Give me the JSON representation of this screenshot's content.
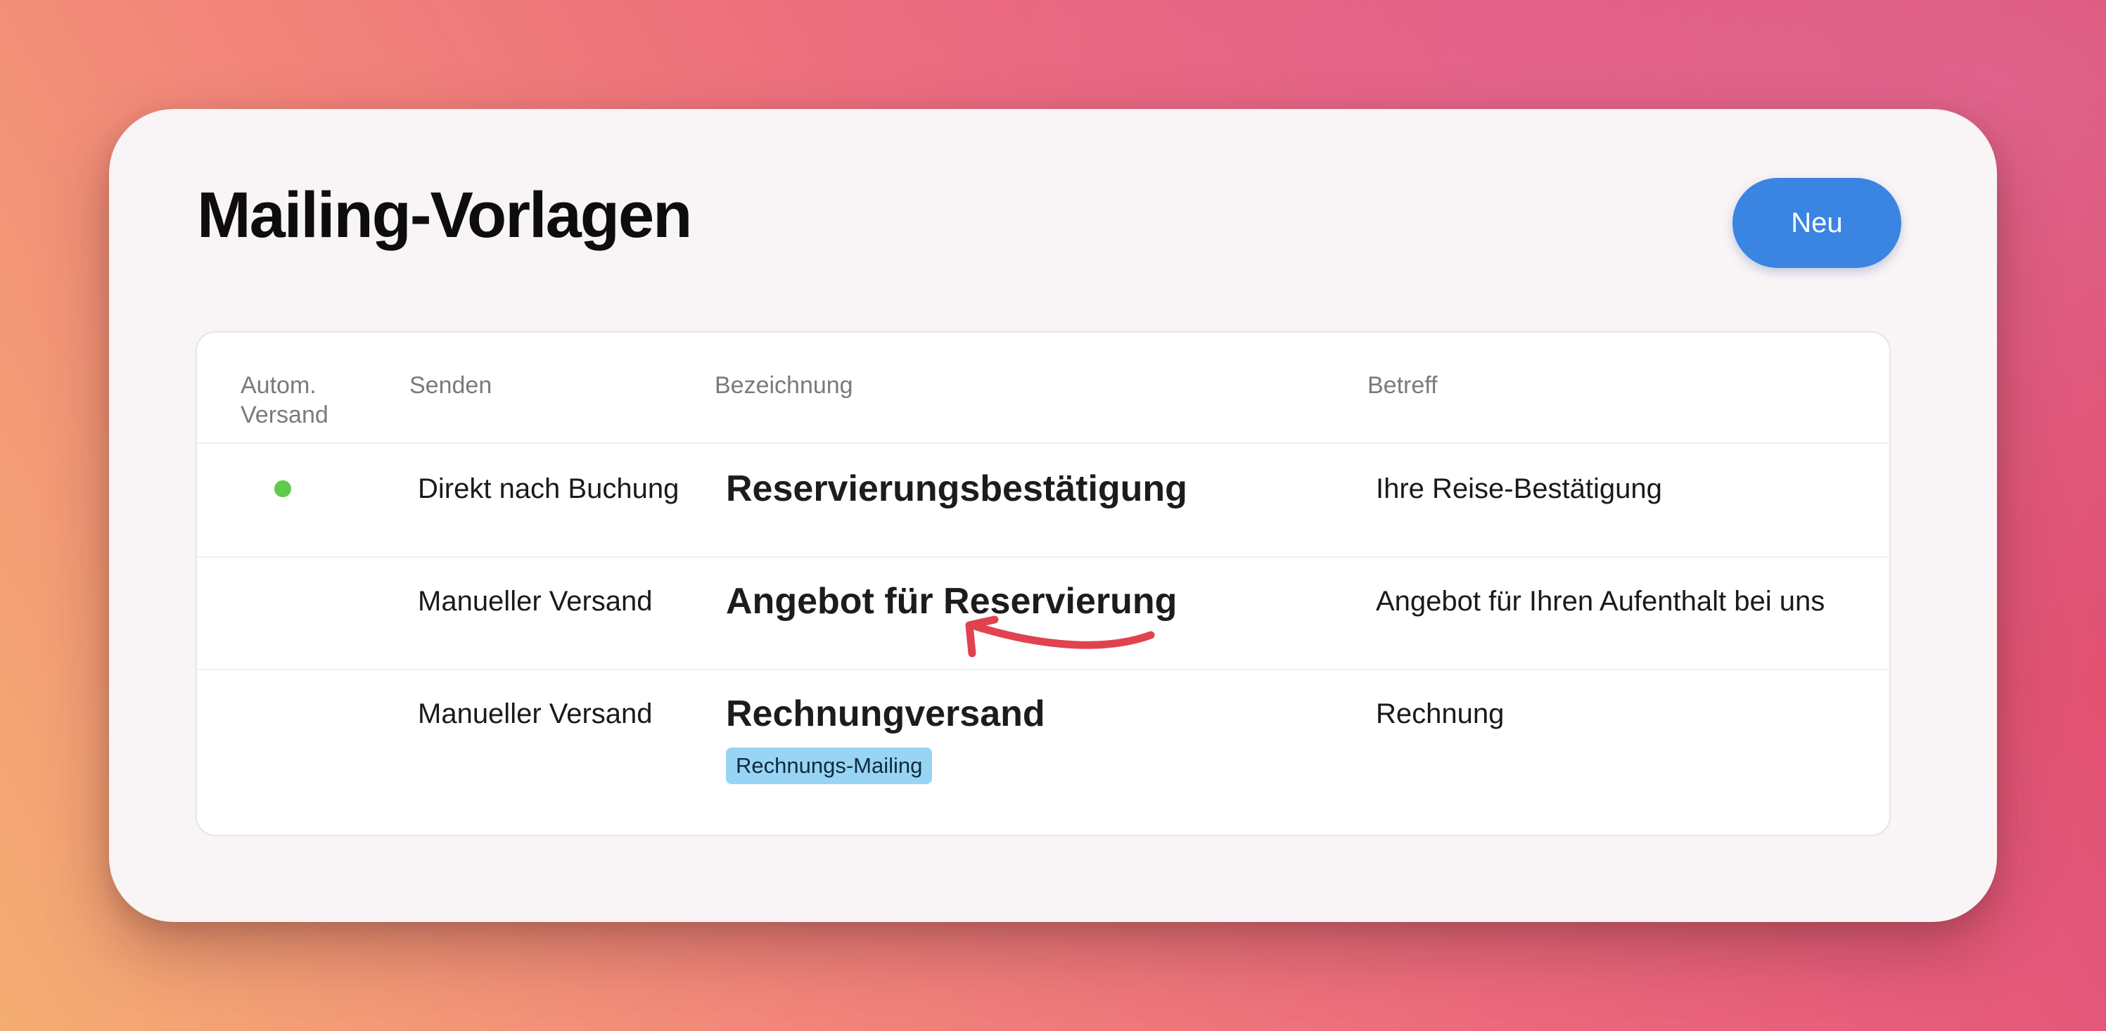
{
  "page": {
    "title": "Mailing-Vorlagen",
    "new_button_label": "Neu"
  },
  "table": {
    "columns": {
      "auto_send": "Autom. Versand",
      "send": "Senden",
      "name": "Bezeichnung",
      "subject": "Betreff"
    },
    "rows": [
      {
        "auto_send_active": true,
        "send": "Direkt nach Buchung",
        "name": "Reservierungsbestätigung",
        "subject": "Ihre Reise-Bestätigung",
        "tag": ""
      },
      {
        "auto_send_active": false,
        "send": "Manueller Versand",
        "name": "Angebot für Reservierung",
        "subject": "Angebot für Ihren Aufenthalt bei uns",
        "tag": ""
      },
      {
        "auto_send_active": false,
        "send": "Manueller Versand",
        "name": "Rechnungversand",
        "subject": "Rechnung",
        "tag": "Rechnungs-Mailing"
      }
    ]
  },
  "colors": {
    "accent_blue": "#3a84e2",
    "status_green": "#5ccc4a",
    "tag_blue": "#98d4f4",
    "annotation_red": "#e0434f"
  }
}
